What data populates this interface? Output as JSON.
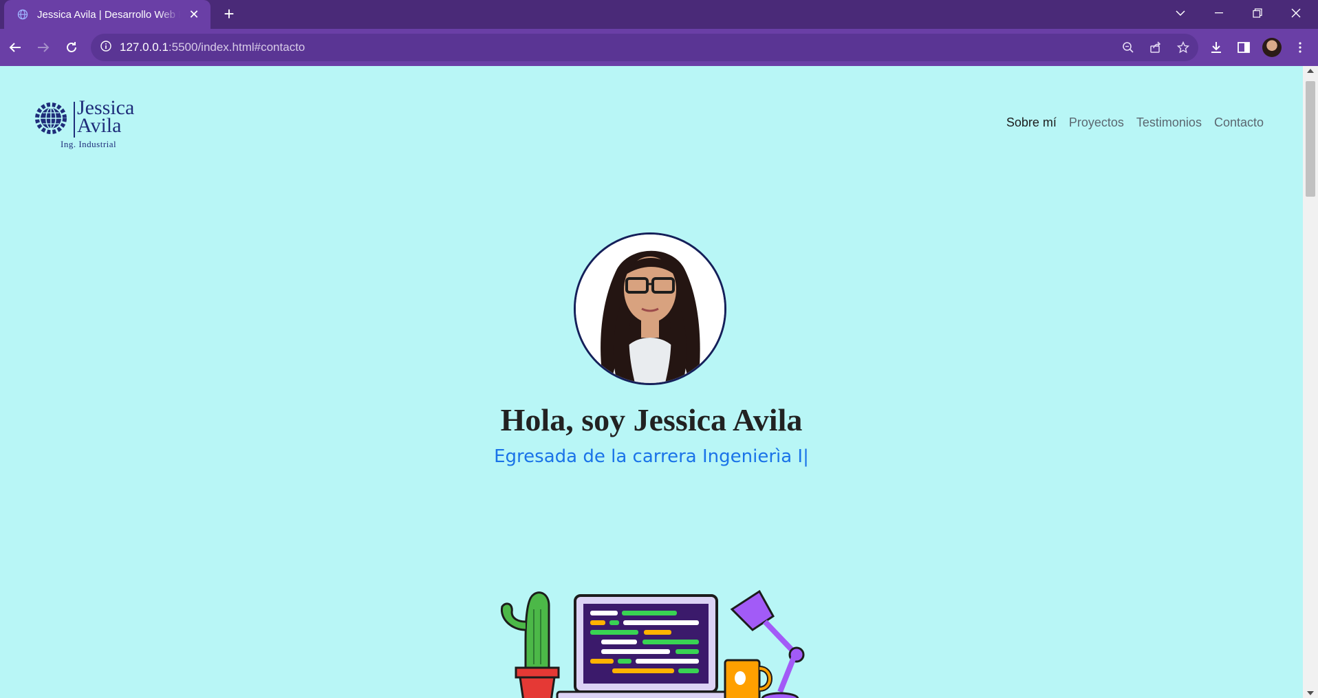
{
  "browser": {
    "tab_title": "Jessica Avila | Desarrollo Web Front",
    "url_host": "127.0.0.1",
    "url_rest": ":5500/index.html#contacto",
    "tab_close": "✕",
    "new_tab": "+"
  },
  "logo": {
    "name_line1": "Jessica",
    "name_line2": "Avila",
    "subtitle": "Ing. Industrial",
    "icon": "globe-gear-icon"
  },
  "nav": {
    "items": [
      {
        "label": "Sobre mí",
        "active": true
      },
      {
        "label": "Proyectos",
        "active": false
      },
      {
        "label": "Testimonios",
        "active": false
      },
      {
        "label": "Contacto",
        "active": false
      }
    ]
  },
  "hero": {
    "title": "Hola, soy Jessica Avila",
    "subtitle": "Egresada de la carrera Ingenierìa I|"
  },
  "colors": {
    "page_bg": "#b8f6f6",
    "chrome_tab": "#6a3fa6",
    "chrome_bar": "#4a2a78",
    "accent_text": "#1a73e8",
    "logo_blue": "#1f2d7a"
  }
}
